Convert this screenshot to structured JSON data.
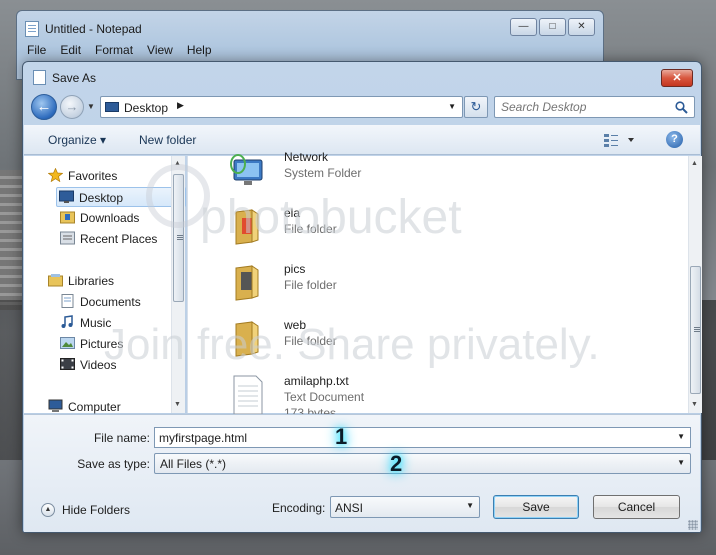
{
  "notepad": {
    "title": "Untitled - Notepad",
    "menu": [
      "File",
      "Edit",
      "Format",
      "View",
      "Help"
    ],
    "controls": {
      "minimize": "—",
      "maximize": "□",
      "close": "✕"
    }
  },
  "dialog": {
    "title": "Save As",
    "close_symbol": "✕",
    "nav": {
      "address": "Desktop",
      "search_placeholder": "Search Desktop"
    },
    "toolbar": {
      "organize": "Organize ▾",
      "new_folder": "New folder"
    },
    "sidebar": {
      "items": [
        {
          "label": "Favorites",
          "icon": "star-icon"
        },
        {
          "label": "Desktop",
          "icon": "desktop-icon",
          "selected": true
        },
        {
          "label": "Downloads",
          "icon": "downloads-folder-icon"
        },
        {
          "label": "Recent Places",
          "icon": "recent-places-icon"
        },
        {
          "label": "Libraries",
          "icon": "libraries-icon"
        },
        {
          "label": "Documents",
          "icon": "documents-icon"
        },
        {
          "label": "Music",
          "icon": "music-icon"
        },
        {
          "label": "Pictures",
          "icon": "pictures-icon"
        },
        {
          "label": "Videos",
          "icon": "videos-icon"
        },
        {
          "label": "Computer",
          "icon": "computer-icon"
        }
      ]
    },
    "files": [
      {
        "name": "Network",
        "type": "System Folder",
        "size": "",
        "icon": "network-icon"
      },
      {
        "name": "ela",
        "type": "File folder",
        "size": "",
        "icon": "folder-icon"
      },
      {
        "name": "pics",
        "type": "File folder",
        "size": "",
        "icon": "folder-icon"
      },
      {
        "name": "web",
        "type": "File folder",
        "size": "",
        "icon": "folder-icon"
      },
      {
        "name": "amilaphp.txt",
        "type": "Text Document",
        "size": "173 bytes",
        "icon": "text-document-icon"
      }
    ],
    "form": {
      "file_name_label": "File name:",
      "file_name_value": "myfirstpage.html",
      "save_type_label": "Save as type:",
      "save_type_value": "All Files  (*.*)",
      "callout_1": "1",
      "callout_2": "2",
      "hide_folders": "Hide Folders",
      "encoding_label": "Encoding:",
      "encoding_value": "ANSI",
      "save_button": "Save",
      "cancel_button": "Cancel"
    }
  },
  "watermark": {
    "brand": "photobucket",
    "slogan": "Join free. Share privately."
  },
  "colors": {
    "accent": "#2d6bbd",
    "callout_glow": "#2ad8ff",
    "close_red": "#d8573f"
  }
}
